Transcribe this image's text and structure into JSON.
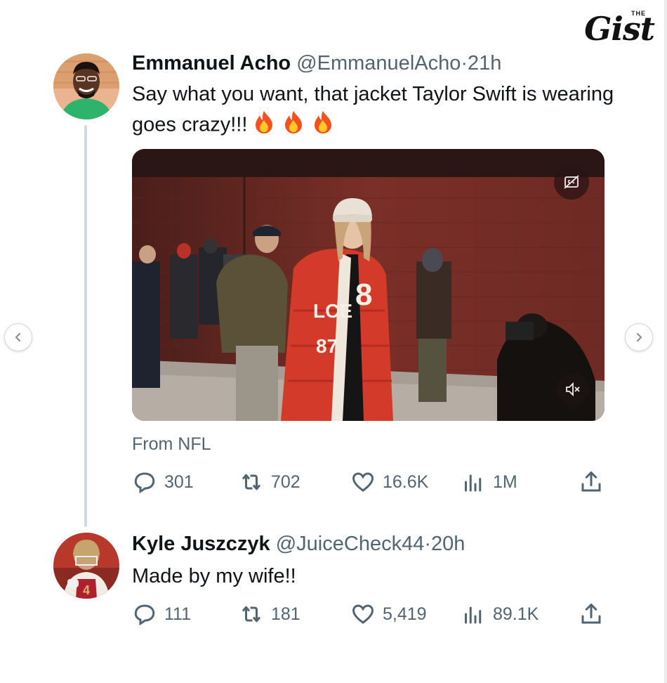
{
  "brand": {
    "the": "THE",
    "name": "Gist"
  },
  "tweets": [
    {
      "name": "Emmanuel Acho",
      "handle": "@EmmanuelAcho",
      "separator": "·",
      "time": "21h",
      "text": "Say what you want, that jacket Taylor Swift is wearing goes crazy!!!",
      "emoji": [
        "fire",
        "fire",
        "fire"
      ],
      "media": {
        "jacket_lettering": [
          "LCE",
          "87",
          "8"
        ]
      },
      "source": "From NFL",
      "stats": {
        "replies": "301",
        "reposts": "702",
        "likes": "16.6K",
        "views": "1M"
      }
    },
    {
      "name": "Kyle Juszczyk",
      "handle": "@JuiceCheck44",
      "separator": "·",
      "time": "20h",
      "text": "Made by my wife!!",
      "stats": {
        "replies": "111",
        "reposts": "181",
        "likes": "5,419",
        "views": "89.1K"
      }
    }
  ],
  "icons": [
    "reply-icon",
    "repost-icon",
    "like-icon",
    "views-icon",
    "share-icon",
    "captions-icon",
    "mute-icon",
    "chevron-left-icon",
    "chevron-right-icon"
  ],
  "colors": {
    "text": "#0f1419",
    "muted": "#536471",
    "thread": "#cfd9de",
    "jacket": "#d43a2a"
  }
}
